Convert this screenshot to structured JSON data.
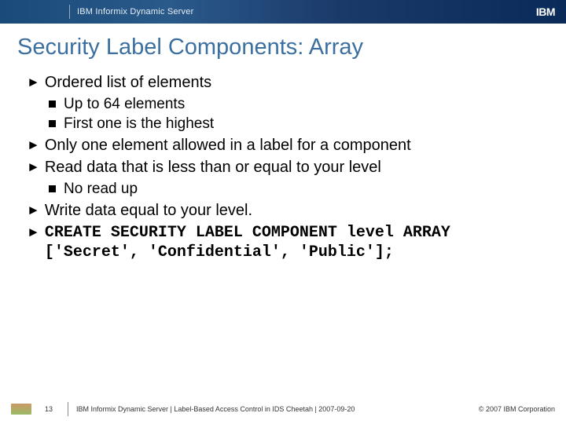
{
  "header": {
    "product": "IBM Informix Dynamic Server",
    "logo": "IBM"
  },
  "title": "Security Label Components: Array",
  "bullets": {
    "b1": "Ordered list of elements",
    "b1a": "Up to 64 elements",
    "b1b": "First one is the highest",
    "b2": "Only one element allowed in a label for a component",
    "b3": "Read data that is less than or equal to your level",
    "b3a": "No read up",
    "b4": "Write data equal to your level.",
    "code": "CREATE SECURITY LABEL COMPONENT level ARRAY ['Secret', 'Confidential', 'Public'];"
  },
  "footer": {
    "page": "13",
    "text": "IBM Informix Dynamic Server |  Label-Based Access Control in IDS Cheetah | 2007-09-20",
    "copyright": "© 2007 IBM Corporation"
  }
}
